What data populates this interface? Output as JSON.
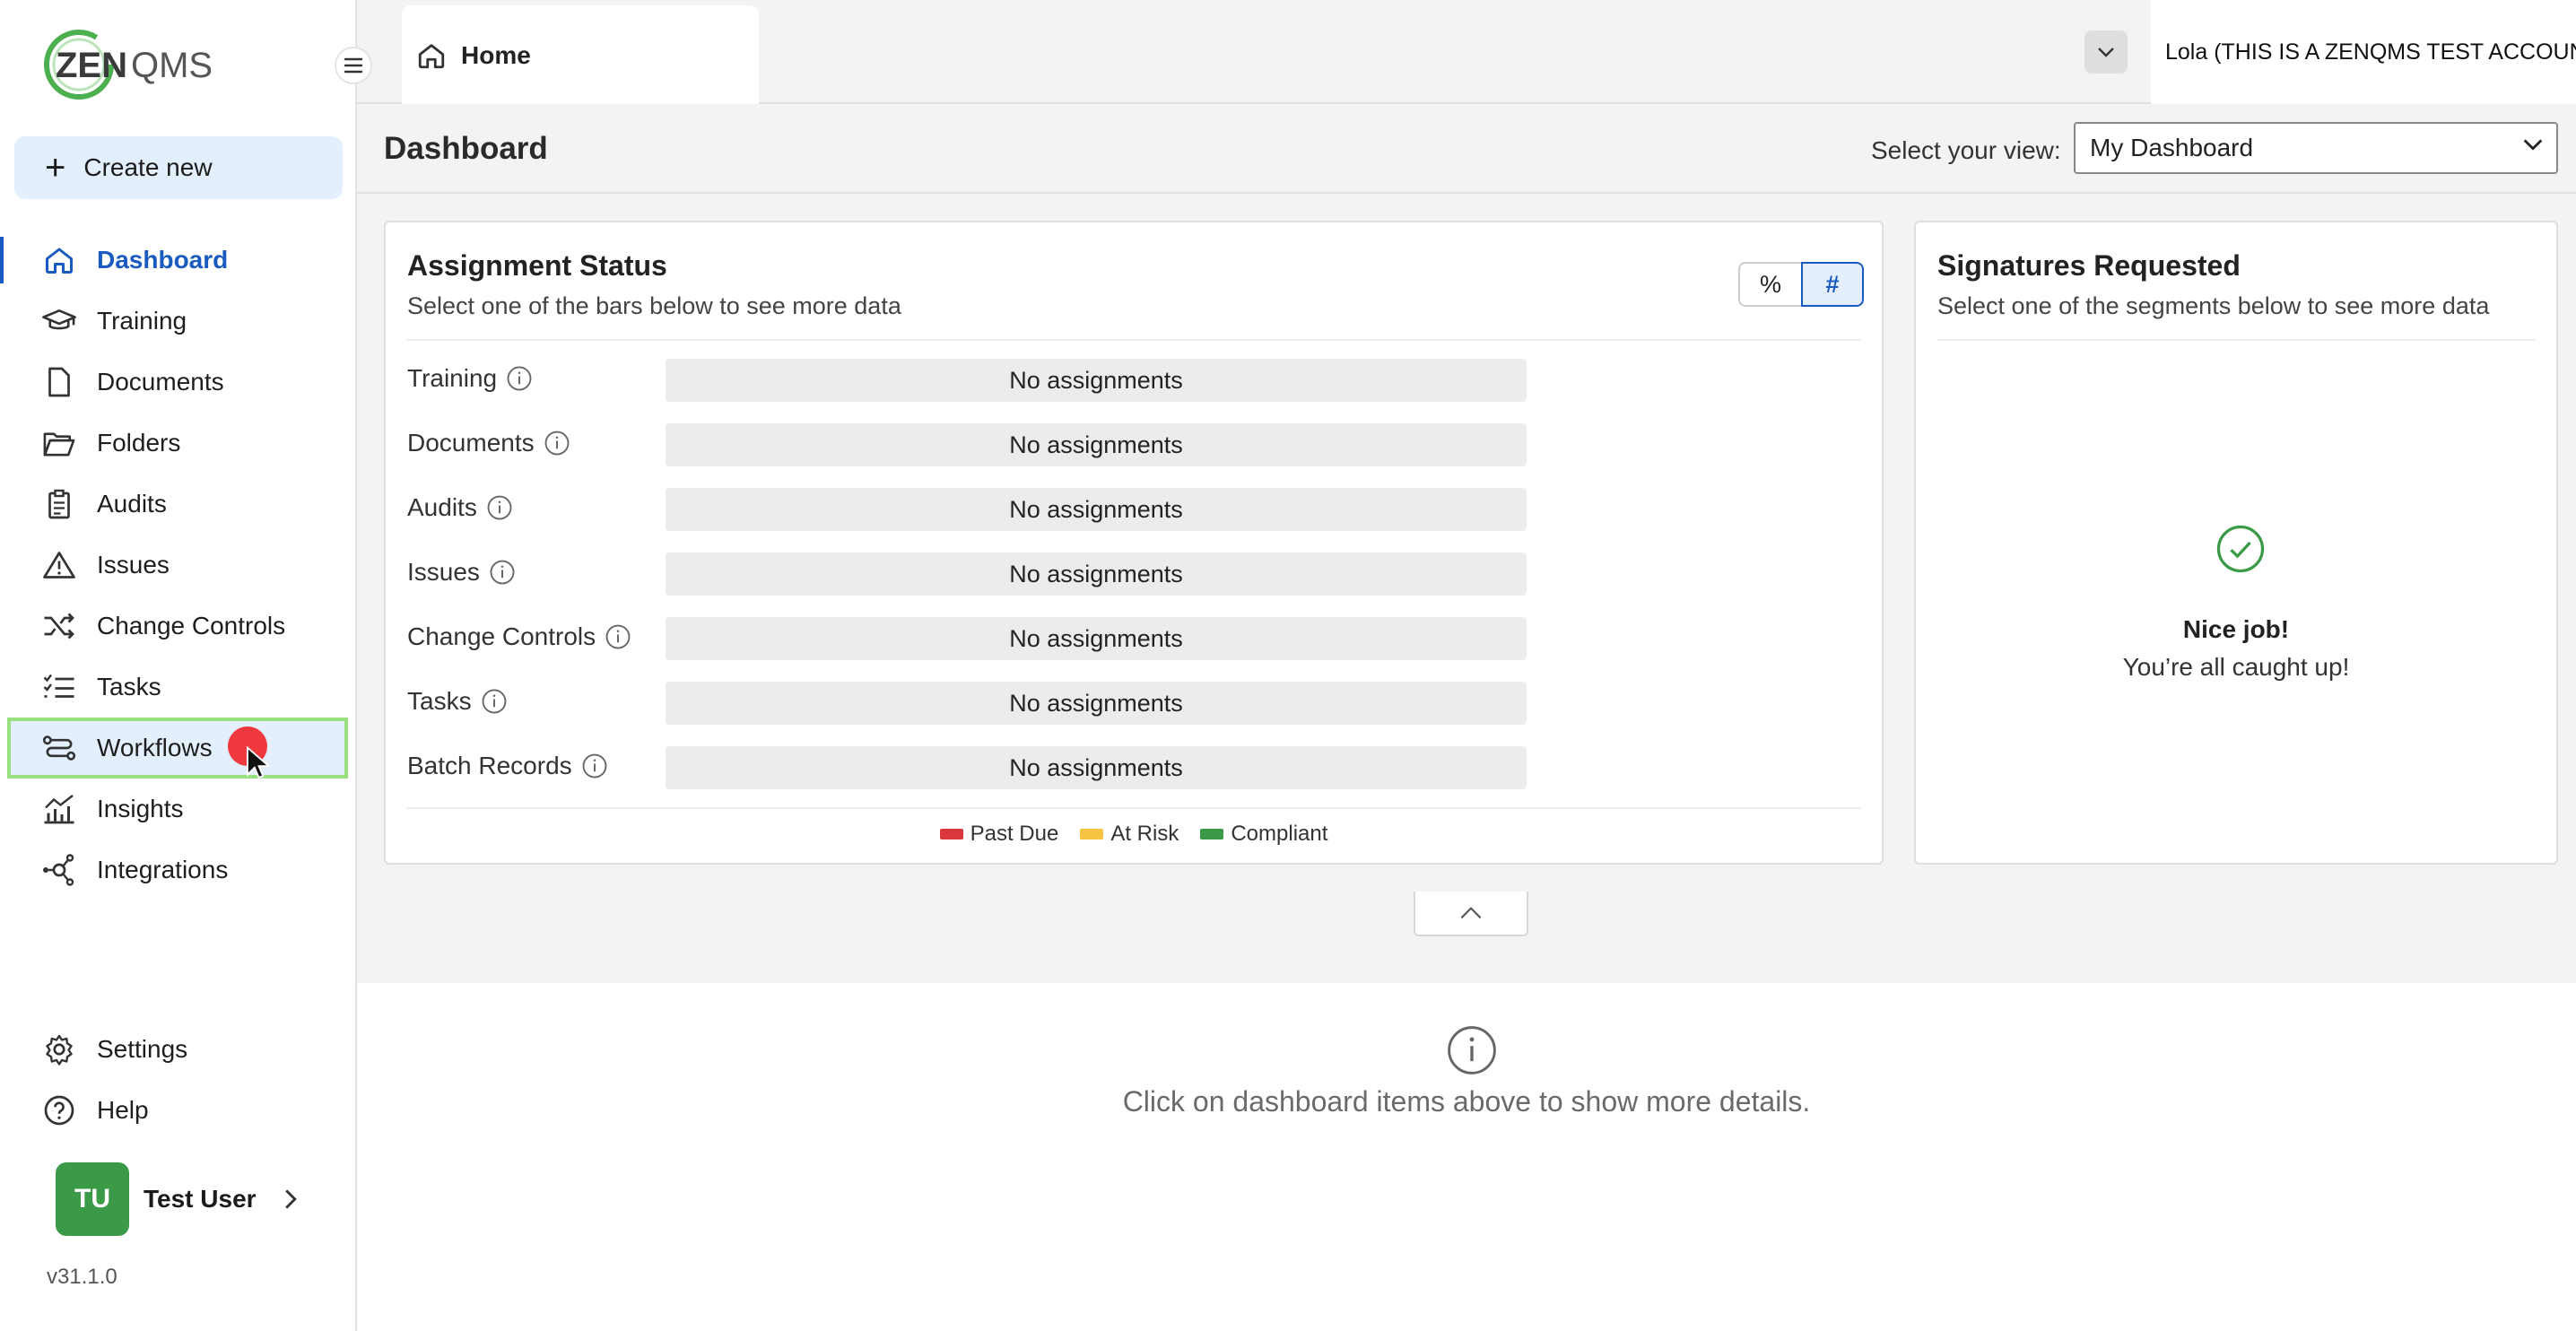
{
  "brand": {
    "logo_text_zen": "ZEN",
    "logo_text_qms": "QMS",
    "logo_color": "#3aa84b"
  },
  "sidebar": {
    "create_label": "Create new",
    "items": [
      {
        "label": "Dashboard",
        "icon": "home-icon",
        "active": true
      },
      {
        "label": "Training",
        "icon": "graduation-cap-icon"
      },
      {
        "label": "Documents",
        "icon": "document-icon"
      },
      {
        "label": "Folders",
        "icon": "folder-open-icon"
      },
      {
        "label": "Audits",
        "icon": "clipboard-icon"
      },
      {
        "label": "Issues",
        "icon": "warning-triangle-icon"
      },
      {
        "label": "Change Controls",
        "icon": "shuffle-icon"
      },
      {
        "label": "Tasks",
        "icon": "task-list-icon"
      },
      {
        "label": "Workflows",
        "icon": "workflow-icon",
        "hovered": true
      },
      {
        "label": "Insights",
        "icon": "insights-chart-icon"
      },
      {
        "label": "Integrations",
        "icon": "integrations-icon"
      }
    ],
    "bottom_items": [
      {
        "label": "Settings",
        "icon": "gear-icon"
      },
      {
        "label": "Help",
        "icon": "help-circle-icon"
      }
    ],
    "user": {
      "initials": "TU",
      "name": "Test User",
      "avatar_color": "#3a9a48"
    },
    "version": "v31.1.0"
  },
  "topbar": {
    "tab_home": "Home",
    "account": "Lola (THIS IS A ZENQMS TEST ACCOUNT)"
  },
  "page": {
    "title": "Dashboard",
    "view_label": "Select your view:",
    "view_value": "My Dashboard"
  },
  "assignment": {
    "title": "Assignment Status",
    "subtitle": "Select one of the bars below to see more data",
    "toggle_pct": "%",
    "toggle_num": "#",
    "rows": [
      {
        "label": "Training",
        "status": "No assignments"
      },
      {
        "label": "Documents",
        "status": "No assignments"
      },
      {
        "label": "Audits",
        "status": "No assignments"
      },
      {
        "label": "Issues",
        "status": "No assignments"
      },
      {
        "label": "Change Controls",
        "status": "No assignments"
      },
      {
        "label": "Tasks",
        "status": "No assignments"
      },
      {
        "label": "Batch Records",
        "status": "No assignments"
      }
    ],
    "legend": [
      {
        "label": "Past Due",
        "color": "#d9363e"
      },
      {
        "label": "At Risk",
        "color": "#f5c542"
      },
      {
        "label": "Compliant",
        "color": "#3a9a48"
      }
    ]
  },
  "signatures": {
    "title": "Signatures Requested",
    "subtitle": "Select one of the segments below to see more data",
    "empty_title": "Nice job!",
    "empty_text": "You’re all caught up!"
  },
  "details": {
    "hint": "Click on dashboard items above to show more details."
  },
  "colors": {
    "accent": "#1a5bbf",
    "accent_bg": "#e3effd",
    "hover_outline": "#9be07f"
  }
}
